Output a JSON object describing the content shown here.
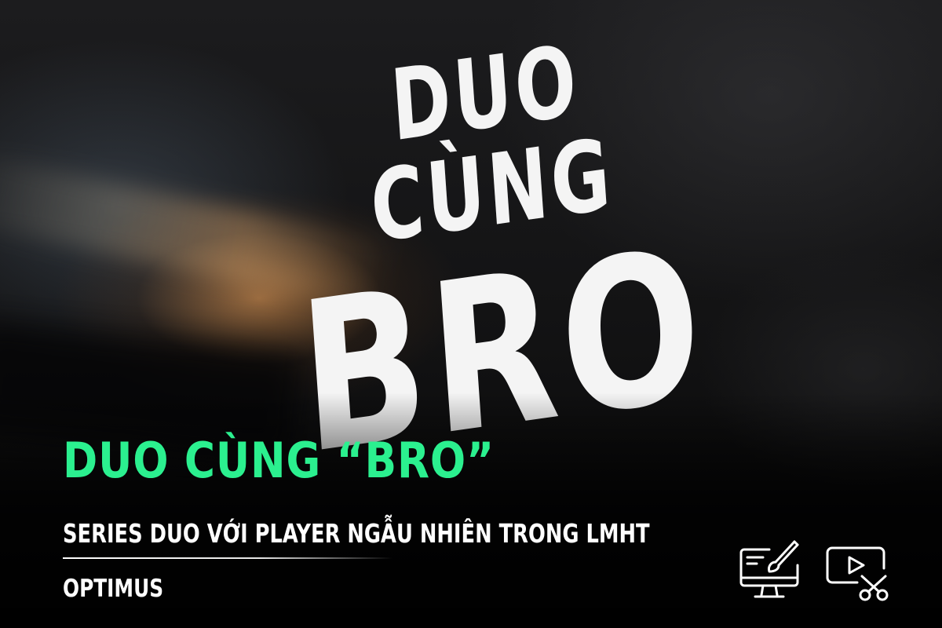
{
  "background_poster": {
    "line1": "DUO CÙNG",
    "line2": "BRO"
  },
  "title": "DUO CÙNG “BRO”",
  "subtitle": "SERIES DUO VỚI PLAYER NGẪU NHIÊN TRONG LMHT",
  "author": "OPTIMUS",
  "icons": {
    "left": "monitor-paintbrush-icon",
    "right": "video-scissors-icon"
  },
  "colors": {
    "title": "#2bf08f",
    "text": "#ffffff",
    "background": "#0b0b0c"
  }
}
